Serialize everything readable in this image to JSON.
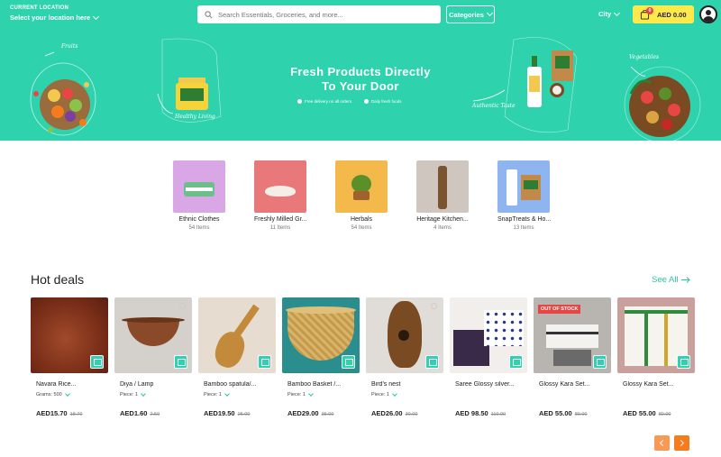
{
  "header": {
    "location_label": "CURRENT LOCATION",
    "location_value": "Select your location here",
    "search_placeholder": "Search Essentials, Groceries, and more...",
    "categories_label": "Categories",
    "city_label": "City",
    "cart_total": "AED 0.00",
    "cart_count": "0"
  },
  "banner": {
    "title_line1": "Fresh Products Directly",
    "title_line2": "To Your Door",
    "feature1": "Free delivery on all orders",
    "feature2": "Daily fresh foods",
    "tag_fruits": "Fruits",
    "tag_healthy": "Healthy Living",
    "tag_authentic": "Authentic Taste",
    "tag_vegetables": "Vegetables"
  },
  "categories": [
    {
      "name": "Ethnic Clothes",
      "count": "54 Items",
      "color": "#d9a6e6"
    },
    {
      "name": "Freshly Milled Gr...",
      "count": "11 Items",
      "color": "#e8787a"
    },
    {
      "name": "Herbals",
      "count": "54 Items",
      "color": "#f3b94a"
    },
    {
      "name": "Heritage Kitchen...",
      "count": "4 Items",
      "color": "#cfc7bf"
    },
    {
      "name": "SnapTreats & Ho...",
      "count": "13 Items",
      "color": "#8fb5f0"
    }
  ],
  "hot_deals": {
    "title": "Hot deals",
    "see_all": "See All",
    "products": [
      {
        "name": "Navara Rice...",
        "variant": "Grams: 500",
        "price": "AED15.70",
        "old_price": "18.70",
        "color": "#8a3a22"
      },
      {
        "name": "Diya / Lamp",
        "variant": "Piece: 1",
        "price": "AED1.60",
        "old_price": "2.50",
        "color": "#c8c4c0"
      },
      {
        "name": "Bamboo spatula/...",
        "variant": "Piece: 1",
        "price": "AED19.50",
        "old_price": "25.00",
        "color": "#ddd3c6"
      },
      {
        "name": "Bamboo Basket /...",
        "variant": "Piece: 1",
        "price": "AED29.00",
        "old_price": "35.00",
        "color": "#2a8e8e"
      },
      {
        "name": "Bird's nest",
        "variant": "Piece: 1",
        "price": "AED26.00",
        "old_price": "30.00",
        "color": "#e0dcd8"
      },
      {
        "name": "Saree Glossy silver...",
        "variant": "",
        "price": "AED 98.50",
        "old_price": "110.00",
        "color": "#f1eeec"
      },
      {
        "name": "Glossy Kara Set...",
        "variant": "",
        "price": "AED 55.00",
        "old_price": "80.00",
        "color": "#b8b4b0",
        "badge": "OUT OF STOCK"
      },
      {
        "name": "Glossy Kara Set...",
        "variant": "",
        "price": "AED 55.00",
        "old_price": "80.00",
        "color": "#c9a09c"
      }
    ]
  }
}
